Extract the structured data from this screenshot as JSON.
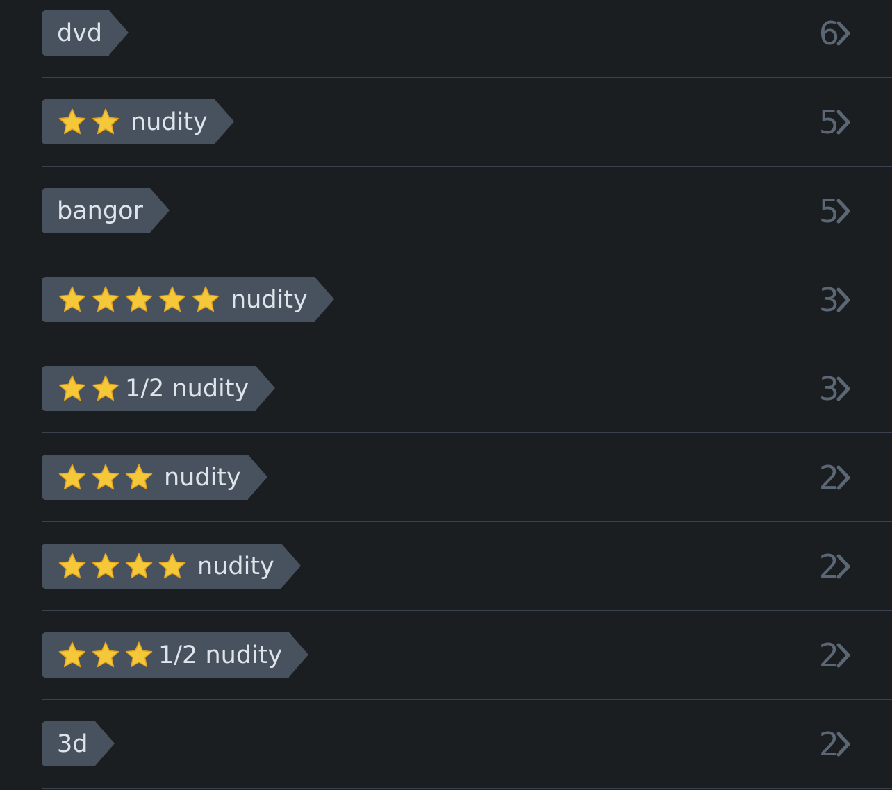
{
  "colors": {
    "background": "#1b1e21",
    "pill": "#48525f",
    "pill_text": "#dfe4ea",
    "count_text": "#5c6775",
    "chevron": "#5c6775",
    "divider": "#3a424d",
    "star": "#f5c83a"
  },
  "tags": [
    {
      "label": "dvd",
      "stars": 0,
      "count": "6"
    },
    {
      "label": "nudity",
      "stars": 2,
      "count": "5"
    },
    {
      "label": "bangor",
      "stars": 0,
      "count": "5"
    },
    {
      "label": "nudity",
      "stars": 5,
      "count": "3"
    },
    {
      "label": "1/2 nudity",
      "stars": 2,
      "count": "3"
    },
    {
      "label": "nudity",
      "stars": 3,
      "count": "2"
    },
    {
      "label": "nudity",
      "stars": 4,
      "count": "2"
    },
    {
      "label": "1/2 nudity",
      "stars": 3,
      "count": "2"
    },
    {
      "label": "3d",
      "stars": 0,
      "count": "2"
    }
  ],
  "icons": {
    "star": "star-emoji-icon",
    "chevron": "chevron-right-icon"
  }
}
